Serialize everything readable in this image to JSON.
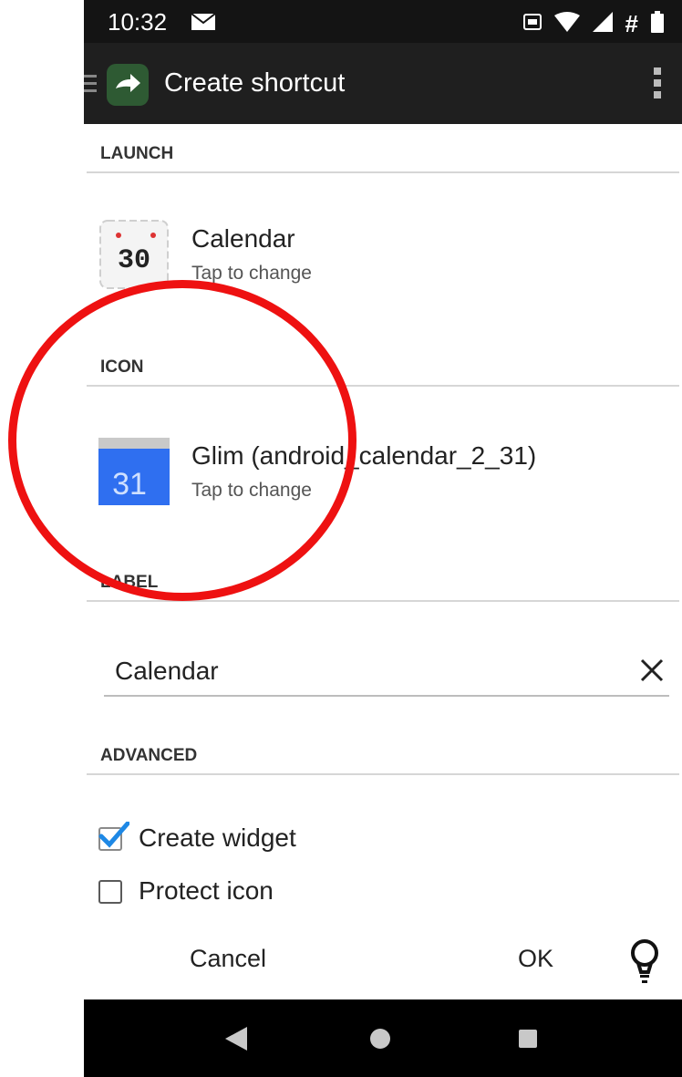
{
  "status_bar": {
    "time": "10:32",
    "icons": [
      "mail-icon",
      "cast-icon",
      "wifi-icon",
      "signal-icon",
      "vpn-hash-icon",
      "battery-icon"
    ],
    "hash": "#"
  },
  "app_bar": {
    "title": "Create shortcut",
    "icons": [
      "menu-handle-icon",
      "arrow-right-icon",
      "overflow-menu-icon"
    ]
  },
  "sections": {
    "launch": "LAUNCH",
    "icon": "ICON",
    "label": "LABEL",
    "advanced": "ADVANCED"
  },
  "launch": {
    "title": "Calendar",
    "subtitle": "Tap to change",
    "icon_number": "30"
  },
  "icon": {
    "title": "Glim (android_calendar_2_31)",
    "subtitle": "Tap to change",
    "icon_number": "31"
  },
  "label_field": {
    "value": "Calendar"
  },
  "advanced": {
    "create_widget": {
      "label": "Create widget",
      "checked": true
    },
    "protect_icon": {
      "label": "Protect icon",
      "checked": false
    }
  },
  "footer": {
    "cancel": "Cancel",
    "ok": "OK"
  },
  "colors": {
    "status_bar": "#141414",
    "app_bar": "#1f1f1f",
    "checkbox_accent": "#1e88e5",
    "calendar_blue": "#2f6ff0",
    "highlight": "#ee1111"
  }
}
